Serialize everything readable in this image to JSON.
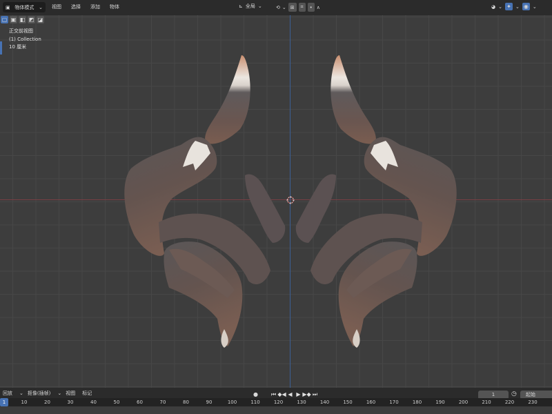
{
  "header": {
    "mode_label": "物体模式",
    "menus": [
      "视图",
      "选择",
      "添加",
      "物体"
    ],
    "transform_orientation": "全局"
  },
  "viewport": {
    "view_name": "正交前视图",
    "collection": "(1) Collection",
    "scale": "10 厘米"
  },
  "timeline": {
    "menus": [
      "回放",
      "抠像(插帧)",
      "视图",
      "标记"
    ],
    "current_frame": "1",
    "start_label": "起始",
    "ruler_current": "1",
    "ruler_ticks": [
      "10",
      "20",
      "30",
      "40",
      "50",
      "60",
      "70",
      "80",
      "90",
      "100",
      "110",
      "120",
      "130",
      "140",
      "150",
      "160",
      "170",
      "180",
      "190",
      "200",
      "210",
      "220",
      "230"
    ]
  },
  "colors": {
    "accent": "#4772b3",
    "header_bg": "#2b2b2b",
    "viewport_bg": "#3d3d3d",
    "axis_z": "#3b5f96",
    "axis_x": "#7a3e44"
  }
}
